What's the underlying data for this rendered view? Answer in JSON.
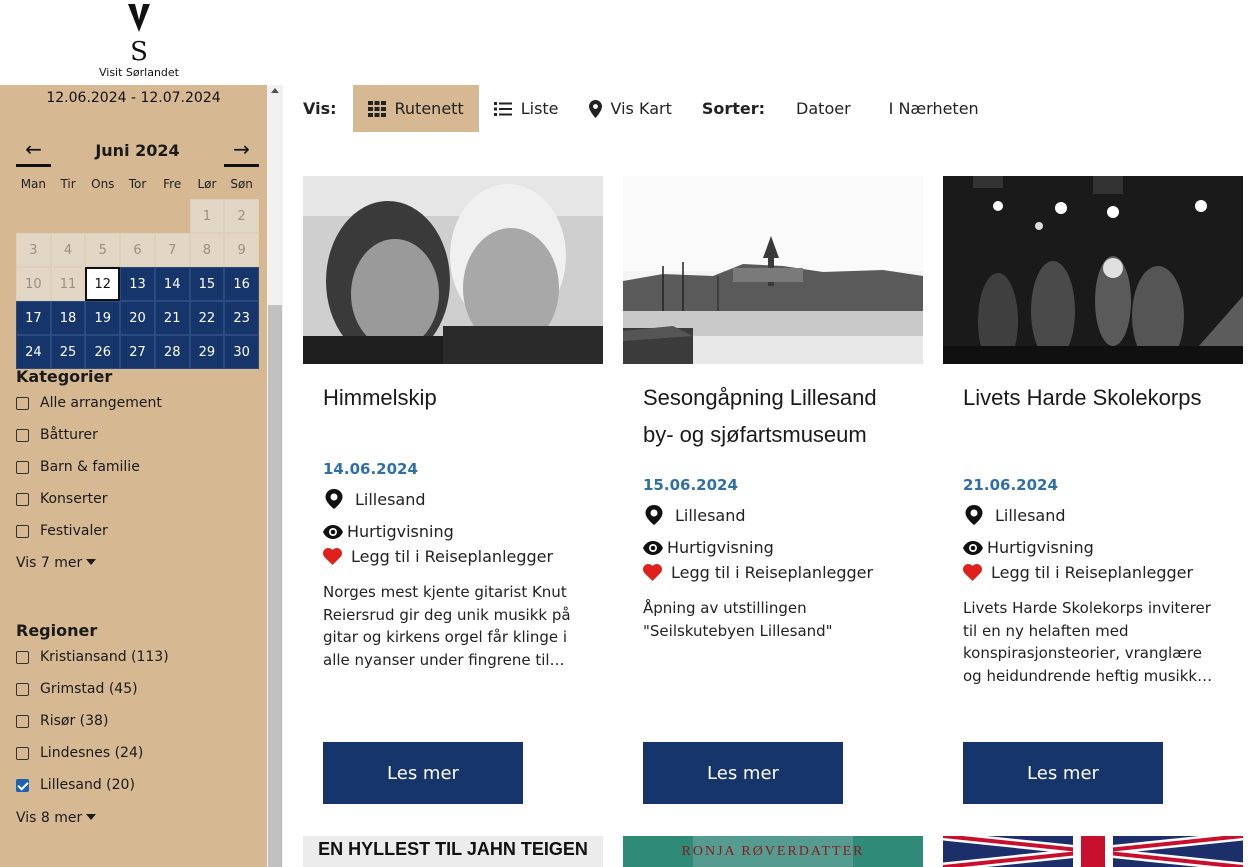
{
  "brand": {
    "logo_text": "Visit Sørlandet"
  },
  "sidebar": {
    "date_range": "12.06.2024 - 12.07.2024",
    "calendar": {
      "prev": "←",
      "next": "→",
      "month": "Juni  2024",
      "weekdays": [
        "Man",
        "Tir",
        "Ons",
        "Tor",
        "Fre",
        "Lør",
        "Søn"
      ],
      "weeks": [
        [
          "",
          "",
          "",
          "",
          "",
          "1",
          "2"
        ],
        [
          "3",
          "4",
          "5",
          "6",
          "7",
          "8",
          "9"
        ],
        [
          "10",
          "11",
          "12",
          "13",
          "14",
          "15",
          "16"
        ],
        [
          "17",
          "18",
          "19",
          "20",
          "21",
          "22",
          "23"
        ],
        [
          "24",
          "25",
          "26",
          "27",
          "28",
          "29",
          "30"
        ]
      ],
      "selected_day": "12"
    },
    "categories": {
      "title": "Kategorier",
      "items": [
        {
          "label": "Alle arrangement",
          "checked": false
        },
        {
          "label": "Båtturer",
          "checked": false
        },
        {
          "label": "Barn & familie",
          "checked": false
        },
        {
          "label": "Konserter",
          "checked": false
        },
        {
          "label": "Festivaler",
          "checked": false
        }
      ],
      "more": "Vis 7 mer"
    },
    "regions": {
      "title": "Regioner",
      "items": [
        {
          "label": "Kristiansand (113)",
          "checked": false
        },
        {
          "label": "Grimstad (45)",
          "checked": false
        },
        {
          "label": "Risør (38)",
          "checked": false
        },
        {
          "label": "Lindesnes (24)",
          "checked": false
        },
        {
          "label": "Lillesand (20)",
          "checked": true
        }
      ],
      "more": "Vis 8 mer"
    }
  },
  "toolbar": {
    "vis_label": "Vis:",
    "grid_label": "Rutenett",
    "list_label": "Liste",
    "map_label": "Vis Kart",
    "sort_label": "Sorter:",
    "sort_dates": "Datoer",
    "sort_near": "I Nærheten"
  },
  "cards": [
    {
      "title": "Himmelskip",
      "date": "14.06.2024",
      "location": "Lillesand",
      "quick_view": "Hurtigvisning",
      "planner": "Legg til i Reiseplanlegger",
      "description": "Norges mest kjente gitarist Knut Reiersrud gir deg unik musikk på gitar og kirkens orgel får klinge i alle nyanser under fingrene til…",
      "button": "Les mer"
    },
    {
      "title": "Sesongåpning Lillesand by- og sjøfartsmuseum",
      "date": "15.06.2024",
      "location": "Lillesand",
      "quick_view": "Hurtigvisning",
      "planner": "Legg til i Reiseplanlegger",
      "description": "Åpning av utstillingen \"Seilskutebyen Lillesand\"",
      "button": "Les mer"
    },
    {
      "title": "Livets Harde Skolekorps",
      "date": "21.06.2024",
      "location": "Lillesand",
      "quick_view": "Hurtigvisning",
      "planner": "Legg til i Reiseplanlegger",
      "description": "Livets Harde Skolekorps inviterer til en ny helaften med konspirasjonsteorier, vranglære og heidundrende heftig musikk…",
      "button": "Les mer"
    }
  ],
  "next_row": {
    "card1_banner": "EN HYLLEST TIL JAHN TEIGEN",
    "card2_banner": "RONJA RØVERDATTER"
  },
  "colors": {
    "sidebar_bg": "#d6b992",
    "primary_navy": "#15356b",
    "date_blue": "#2f6fa3",
    "heart_red": "#e0201b"
  }
}
